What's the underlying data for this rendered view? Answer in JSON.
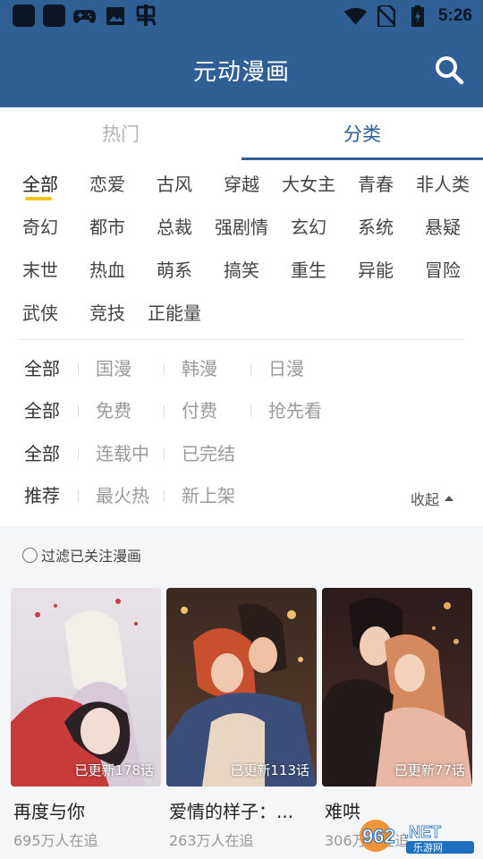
{
  "status_bar": {
    "time": "5:26",
    "icons": [
      "app-square-icon",
      "app-square-icon",
      "gamepad-icon",
      "image-icon",
      "bug-icon",
      "wifi-icon",
      "no-sim-icon",
      "battery-icon"
    ]
  },
  "header": {
    "title": "元动漫画",
    "search_icon": "search-icon"
  },
  "tabs": [
    {
      "label": "热门",
      "active": false
    },
    {
      "label": "分类",
      "active": true
    }
  ],
  "genres": [
    [
      "全部",
      "恋爱",
      "古风",
      "穿越",
      "大女主",
      "青春",
      "非人类"
    ],
    [
      "奇幻",
      "都市",
      "总裁",
      "强剧情",
      "玄幻",
      "系统",
      "悬疑"
    ],
    [
      "末世",
      "热血",
      "萌系",
      "搞笑",
      "重生",
      "异能",
      "冒险"
    ],
    [
      "武侠",
      "竞技",
      "正能量"
    ]
  ],
  "filters": {
    "region": [
      "全部",
      "国漫",
      "韩漫",
      "日漫"
    ],
    "price": [
      "全部",
      "免费",
      "付费",
      "抢先看"
    ],
    "status": [
      "全部",
      "连载中",
      "已完结"
    ],
    "sort": [
      "推荐",
      "最火热",
      "新上架"
    ],
    "collapse_label": "收起"
  },
  "follow_filter": {
    "label": "过滤已关注漫画",
    "checked": false
  },
  "comics": [
    {
      "title": "再度与你",
      "update": "已更新178话",
      "followers": "695万人在追"
    },
    {
      "title": "爱情的样子：...",
      "update": "已更新113话",
      "followers": "263万人在追"
    },
    {
      "title": "难哄",
      "update": "已更新77话",
      "followers": "306万人在追"
    }
  ],
  "watermark": {
    "text": "962.NET",
    "subtext": "乐游网"
  },
  "colors": {
    "primary": "#2f5f95",
    "indicator": "#f5c518",
    "lower_bg": "#f5f6f8"
  }
}
